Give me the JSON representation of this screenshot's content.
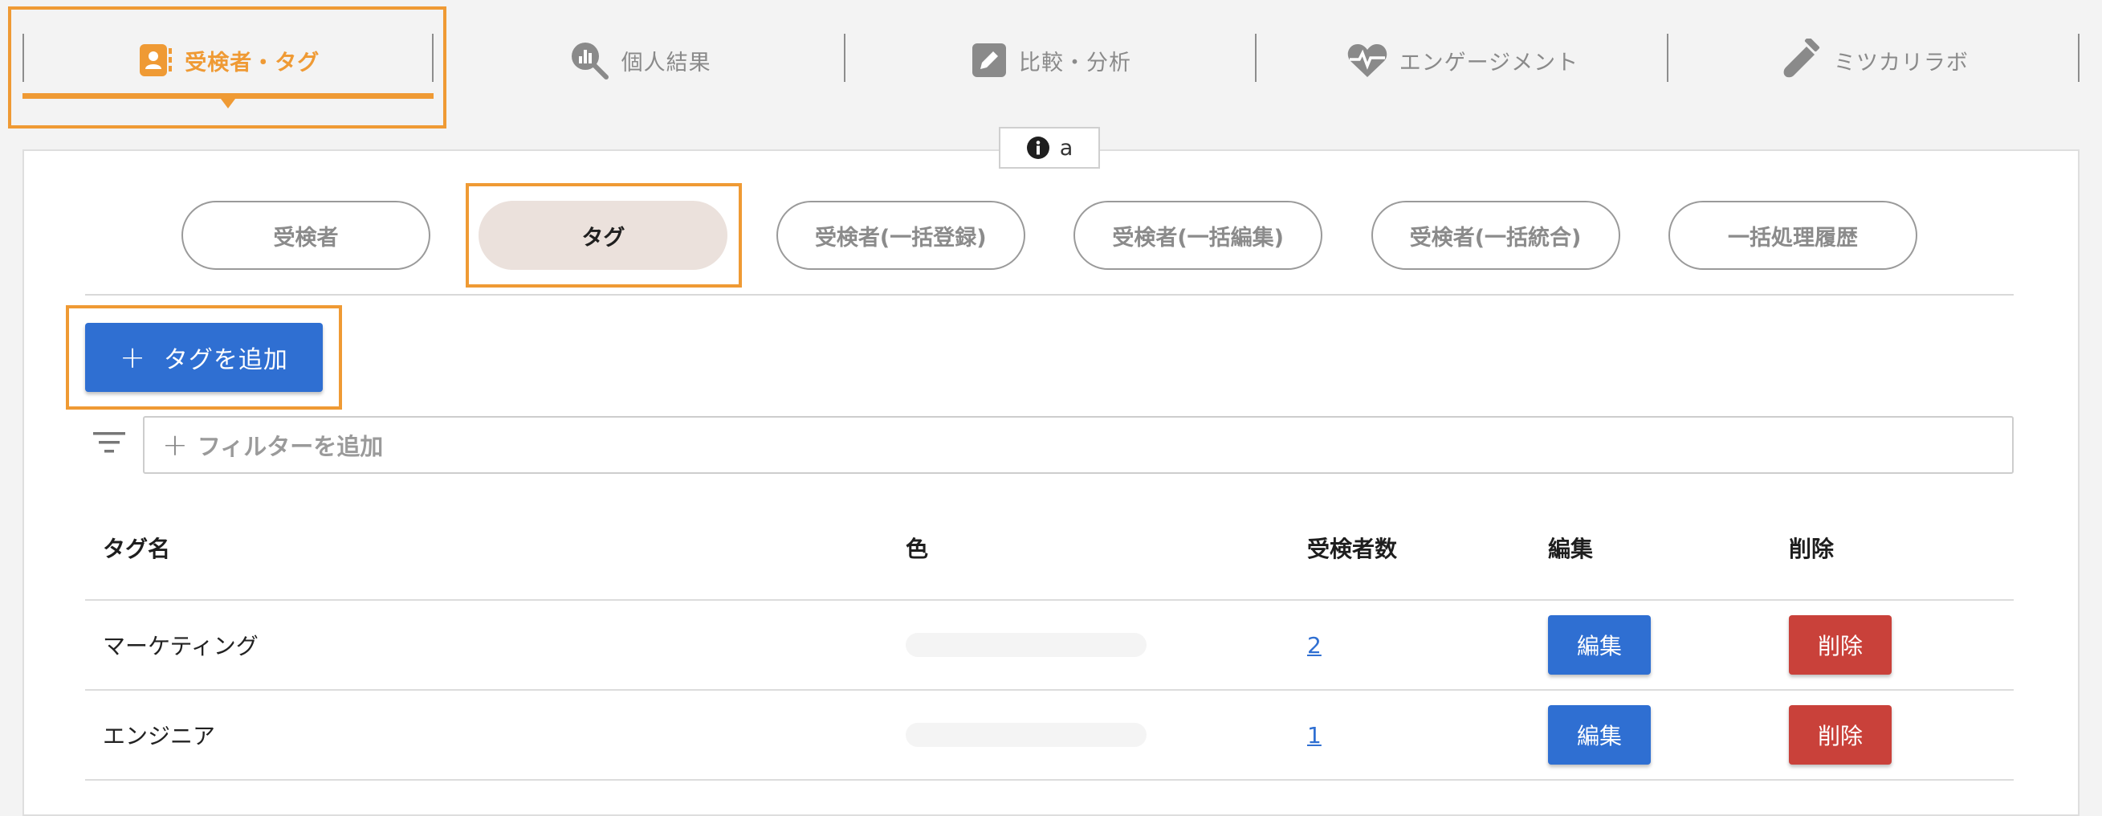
{
  "nav": {
    "tabs": [
      {
        "label": "受検者・タグ",
        "icon": "contact-book-icon",
        "active": true
      },
      {
        "label": "個人結果",
        "icon": "chart-magnifier-icon",
        "active": false
      },
      {
        "label": "比較・分析",
        "icon": "pencil-square-icon",
        "active": false
      },
      {
        "label": "エンゲージメント",
        "icon": "heartbeat-icon",
        "active": false
      },
      {
        "label": "ミツカリラボ",
        "icon": "test-tube-icon",
        "active": false
      }
    ]
  },
  "info_badge": {
    "icon": "info-icon",
    "text": "a"
  },
  "subtabs": [
    {
      "label": "受検者",
      "active": false
    },
    {
      "label": "タグ",
      "active": true
    },
    {
      "label": "受検者(一括登録)",
      "active": false
    },
    {
      "label": "受検者(一括編集)",
      "active": false
    },
    {
      "label": "受検者(一括統合)",
      "active": false
    },
    {
      "label": "一括処理履歴",
      "active": false
    }
  ],
  "add_tag_button": {
    "icon": "plus-icon",
    "label": "タグを追加"
  },
  "filter": {
    "icon": "filter-icon",
    "placeholder": "フィルターを追加"
  },
  "table": {
    "headers": {
      "name": "タグ名",
      "color": "色",
      "count": "受検者数",
      "edit": "編集",
      "delete": "削除"
    },
    "rows": [
      {
        "name": "マーケティング",
        "count": "2",
        "edit": "編集",
        "delete": "削除"
      },
      {
        "name": "エンジニア",
        "count": "1",
        "edit": "編集",
        "delete": "削除"
      }
    ]
  },
  "colors": {
    "accent": "#ef9a34",
    "primary": "#2f6fd2",
    "danger": "#c9413a",
    "active_subtab": "#ebe1dc"
  }
}
